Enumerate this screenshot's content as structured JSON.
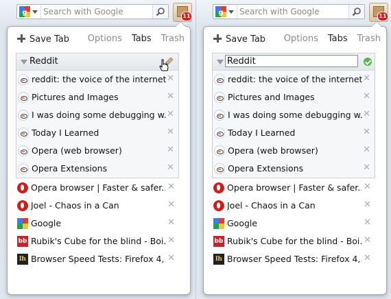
{
  "search": {
    "placeholder": "Search with Google"
  },
  "extension": {
    "badge": "11"
  },
  "toolbar": {
    "save_tab": "Save Tab",
    "tabs": [
      "Options",
      "Tabs",
      "Trash"
    ]
  },
  "group": {
    "title": "Reddit"
  },
  "group_tabs": [
    {
      "title": "reddit: the voice of the internet...",
      "icon": "reddit-icon"
    },
    {
      "title": "Pictures and Images",
      "icon": "reddit-icon"
    },
    {
      "title": "I was doing some debugging w...",
      "icon": "reddit-icon"
    },
    {
      "title": "Today I Learned",
      "icon": "reddit-icon"
    },
    {
      "title": "Opera (web browser)",
      "icon": "reddit-icon"
    },
    {
      "title": "Opera Extensions",
      "icon": "reddit-icon"
    }
  ],
  "loose_tabs": [
    {
      "title": "Opera browser | Faster & safer...",
      "icon": "opera-icon"
    },
    {
      "title": "Joel - Chaos in a Can",
      "icon": "opera-icon"
    },
    {
      "title": "Google",
      "icon": "google-icon"
    },
    {
      "title": "Rubik's Cube for the blind - Boi...",
      "icon": "bb-icon",
      "icon_text": "bb"
    },
    {
      "title": "Browser Speed Tests: Firefox 4,...",
      "icon": "lh-icon",
      "icon_text": "lh"
    }
  ],
  "close_glyph": "✕"
}
